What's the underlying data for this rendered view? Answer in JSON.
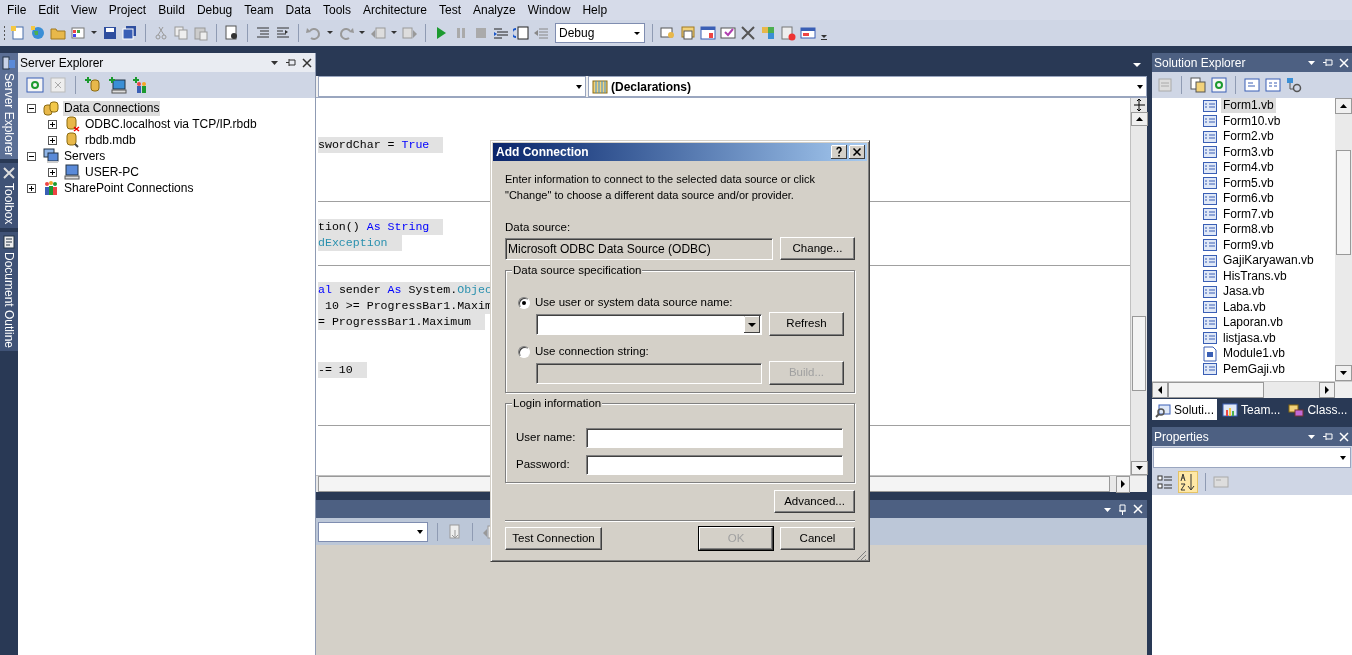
{
  "menu": [
    {
      "label": "File"
    },
    {
      "label": "Edit"
    },
    {
      "label": "View"
    },
    {
      "label": "Project"
    },
    {
      "label": "Build"
    },
    {
      "label": "Debug"
    },
    {
      "label": "Team"
    },
    {
      "label": "Data"
    },
    {
      "label": "Tools"
    },
    {
      "label": "Architecture"
    },
    {
      "label": "Test"
    },
    {
      "label": "Analyze"
    },
    {
      "label": "Window"
    },
    {
      "label": "Help"
    }
  ],
  "toolbar": {
    "configuration": "Debug"
  },
  "side_tabs": [
    {
      "label": "Server Explorer",
      "selected": true
    },
    {
      "label": "Toolbox",
      "selected": false
    },
    {
      "label": "Document Outline",
      "selected": false
    }
  ],
  "server_explorer": {
    "title": "Server Explorer",
    "tree": [
      {
        "label": "Data Connections",
        "kind": "connections",
        "expanded": true,
        "selected": true,
        "children": [
          {
            "label": "ODBC.localhost via TCP/IP.rbdb",
            "kind": "broken_connection",
            "expanded": false,
            "selected": false
          },
          {
            "label": "rbdb.mdb",
            "kind": "connection",
            "expanded": false,
            "selected": false
          }
        ]
      },
      {
        "label": "Servers",
        "kind": "servers",
        "expanded": true,
        "selected": false,
        "children": [
          {
            "label": "USER-PC",
            "kind": "computer",
            "expanded": false,
            "selected": false
          }
        ]
      },
      {
        "label": "SharePoint Connections",
        "kind": "sharepoint",
        "expanded": false,
        "selected": false
      }
    ]
  },
  "editor": {
    "declarations": "(Declarations)",
    "procedures": [
      {
        "lines": [
          [
            {
              "text": "swordChar = ",
              "kind": "plain"
            },
            {
              "text": "True",
              "kind": "keyword"
            }
          ]
        ]
      },
      {
        "lines": [
          [
            {
              "text": "tion() ",
              "kind": "plain"
            },
            {
              "text": "As String",
              "kind": "keyword"
            }
          ],
          [
            {
              "text": "dException",
              "kind": "type"
            }
          ]
        ]
      },
      {
        "lines": [
          [
            {
              "text": "al",
              "kind": "keyword"
            },
            {
              "text": " sender ",
              "kind": "plain"
            },
            {
              "text": "As",
              "kind": "keyword"
            },
            {
              "text": " System.",
              "kind": "plain"
            },
            {
              "text": "Objec",
              "kind": "type"
            }
          ],
          [
            {
              "text": " 10 >= ProgressBar1.Maxim",
              "kind": "plain"
            }
          ],
          [
            {
              "text": "= ProgressBar1.Maximum",
              "kind": "plain"
            }
          ],
          [
            {
              "text": "-= 10",
              "kind": "plain"
            }
          ]
        ]
      }
    ]
  },
  "dialog": {
    "title": "Add Connection",
    "description": "Enter information to connect to the selected data source or click \"Change\" to choose a different data source and/or provider.",
    "data_source_label": "Data source:",
    "data_source": "Microsoft ODBC Data Source (ODBC)",
    "change_button": "Change...",
    "spec_group": "Data source specification",
    "options": [
      {
        "label": "Use user or system data source name:",
        "selected": true,
        "button": "Refresh",
        "kind": "combo"
      },
      {
        "label": "Use connection string:",
        "selected": false,
        "button": "Build...",
        "kind": "text"
      }
    ],
    "login_group": "Login information",
    "user_label": "User name:",
    "password_label": "Password:",
    "advanced_button": "Advanced...",
    "test_button": "Test Connection",
    "ok_button": "OK",
    "ok_disabled": true,
    "cancel_button": "Cancel"
  },
  "solution_explorer": {
    "title": "Solution Explorer",
    "files": [
      {
        "name": "Form1.vb",
        "kind": "form",
        "selected": true
      },
      {
        "name": "Form10.vb",
        "kind": "form",
        "selected": false
      },
      {
        "name": "Form2.vb",
        "kind": "form",
        "selected": false
      },
      {
        "name": "Form3.vb",
        "kind": "form",
        "selected": false
      },
      {
        "name": "Form4.vb",
        "kind": "form",
        "selected": false
      },
      {
        "name": "Form5.vb",
        "kind": "form",
        "selected": false
      },
      {
        "name": "Form6.vb",
        "kind": "form",
        "selected": false
      },
      {
        "name": "Form7.vb",
        "kind": "form",
        "selected": false
      },
      {
        "name": "Form8.vb",
        "kind": "form",
        "selected": false
      },
      {
        "name": "Form9.vb",
        "kind": "form",
        "selected": false
      },
      {
        "name": "GajiKaryawan.vb",
        "kind": "form",
        "selected": false
      },
      {
        "name": "HisTrans.vb",
        "kind": "form",
        "selected": false
      },
      {
        "name": "Jasa.vb",
        "kind": "form",
        "selected": false
      },
      {
        "name": "Laba.vb",
        "kind": "form",
        "selected": false
      },
      {
        "name": "Laporan.vb",
        "kind": "form",
        "selected": false
      },
      {
        "name": "listjasa.vb",
        "kind": "form",
        "selected": false
      },
      {
        "name": "Module1.vb",
        "kind": "module",
        "selected": false
      },
      {
        "name": "PemGaji.vb",
        "kind": "form",
        "selected": false
      }
    ],
    "tabs": [
      {
        "label": "Soluti...",
        "kind": "solution",
        "selected": true
      },
      {
        "label": "Team...",
        "kind": "team",
        "selected": false
      },
      {
        "label": "Class...",
        "kind": "class",
        "selected": false
      }
    ]
  },
  "properties": {
    "title": "Properties"
  }
}
